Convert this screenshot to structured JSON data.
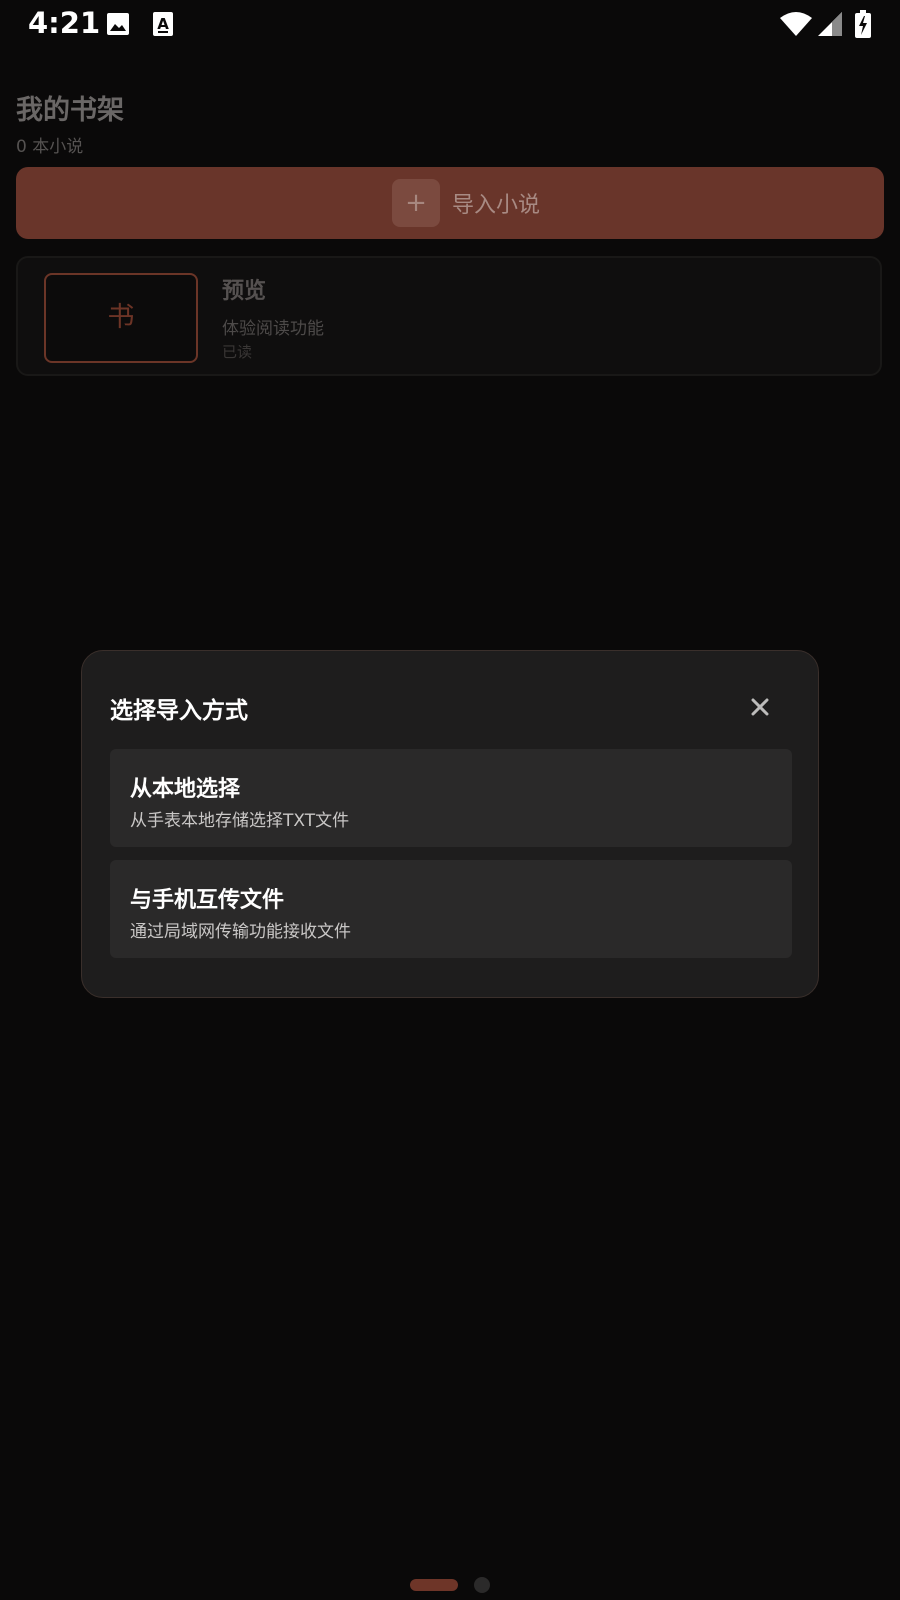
{
  "status_bar": {
    "time": "4:21",
    "icons": [
      "image-icon",
      "a-text-icon",
      "wifi-icon",
      "cellular-signal-icon",
      "battery-charging-icon"
    ]
  },
  "page": {
    "title": "我的书架",
    "subtitle": "0 本小说",
    "import_button": {
      "icon": "+",
      "label": "导入小说"
    },
    "book": {
      "cover_char": "书",
      "title": "预览",
      "description": "体验阅读功能",
      "status": "已读"
    }
  },
  "modal": {
    "title": "选择导入方式",
    "options": [
      {
        "title": "从本地选择",
        "description": "从手表本地存储选择TXT文件"
      },
      {
        "title": "与手机互传文件",
        "description": "通过局域网传输功能接收文件"
      }
    ]
  },
  "colors": {
    "accent": "#6e3528",
    "background": "#0a0909",
    "modal_bg": "#1e1d1d",
    "option_bg": "#2a2929"
  }
}
